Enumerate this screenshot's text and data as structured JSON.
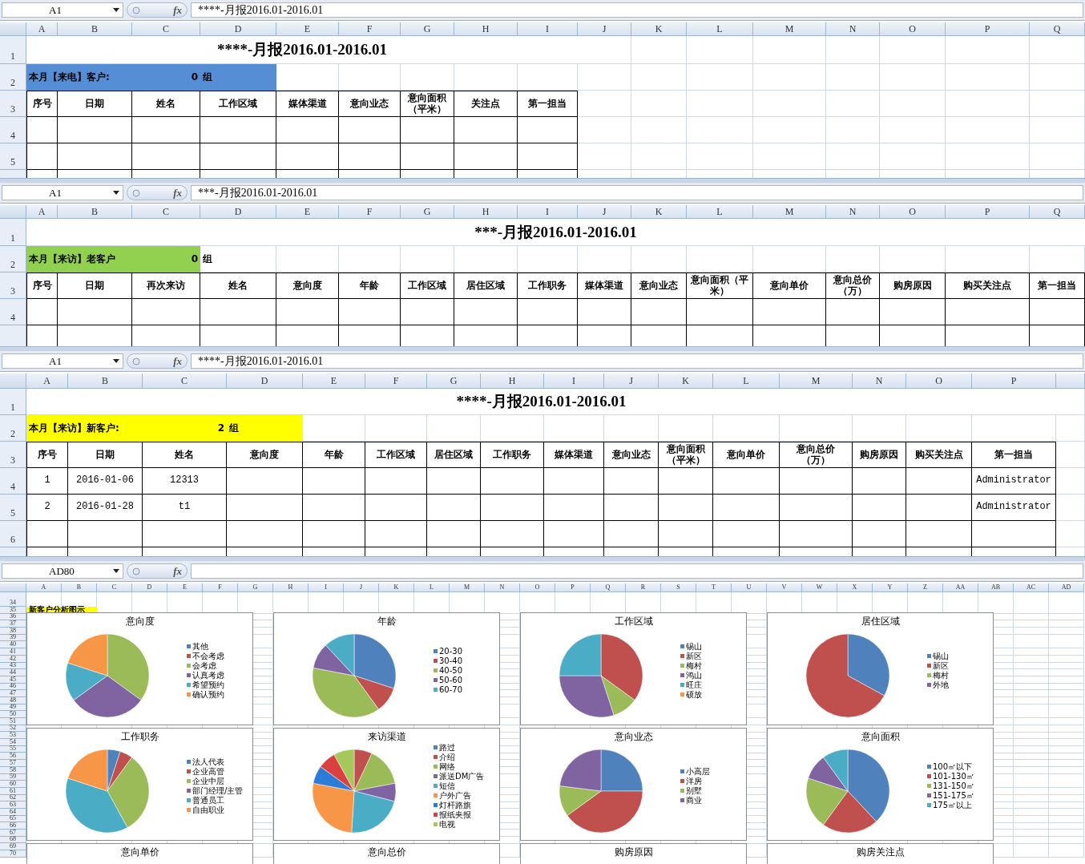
{
  "panes": [
    {
      "name_box": "A1",
      "function_label": "fx",
      "formula": "****-月报2016.01-2016.01",
      "columns": [
        "A",
        "B",
        "C",
        "D",
        "E",
        "F",
        "G",
        "H",
        "I",
        "J",
        "K",
        "L",
        "M",
        "N",
        "O",
        "P",
        "Q"
      ],
      "row_numbers": [
        "1",
        "2",
        "3",
        "4",
        "5"
      ],
      "title": "****-月报2016.01-2016.01",
      "banner": {
        "label": "本月【来电】客户:",
        "count": "0",
        "unit": "组",
        "color": "#558ed5"
      },
      "headers": [
        "序号",
        "日期",
        "姓名",
        "工作区域",
        "媒体渠道",
        "意向业态",
        "意向面积（平米）",
        "关注点",
        "第一担当"
      ]
    },
    {
      "name_box": "A1",
      "function_label": "fx",
      "formula": "***-月报2016.01-2016.01",
      "columns": [
        "A",
        "B",
        "C",
        "D",
        "E",
        "F",
        "G",
        "H",
        "I",
        "J",
        "K",
        "L",
        "M",
        "N",
        "O",
        "P",
        "Q"
      ],
      "row_numbers": [
        "1",
        "2",
        "3",
        "4"
      ],
      "title": "***-月报2016.01-2016.01",
      "banner": {
        "label": "本月【来访】老客户",
        "count": "0",
        "unit": "组",
        "color": "#92d050"
      },
      "headers": [
        "序号",
        "日期",
        "再次来访",
        "姓名",
        "意向度",
        "年龄",
        "工作区域",
        "居住区域",
        "工作职务",
        "媒体渠道",
        "意向业态",
        "意向面积（平米）",
        "意向单价",
        "意向总价（万）",
        "购房原因",
        "购买关注点",
        "第一担当"
      ]
    },
    {
      "name_box": "A1",
      "function_label": "fx",
      "formula": "****-月报2016.01-2016.01",
      "columns": [
        "A",
        "B",
        "C",
        "D",
        "E",
        "F",
        "G",
        "H",
        "I",
        "J",
        "K",
        "L",
        "M",
        "N",
        "O",
        "P"
      ],
      "row_numbers": [
        "1",
        "2",
        "3",
        "4",
        "5",
        "6"
      ],
      "title": "****-月报2016.01-2016.01",
      "banner": {
        "label": "本月【来访】新客户:",
        "count": "2",
        "unit": "组",
        "color": "#ffff00"
      },
      "headers": [
        "序号",
        "日期",
        "姓名",
        "意向度",
        "年龄",
        "工作区域",
        "居住区域",
        "工作职务",
        "媒体渠道",
        "意向业态",
        "意向面积（平米）",
        "意向单价",
        "意向总价（万）",
        "购房原因",
        "购买关注点",
        "第一担当"
      ],
      "data_rows": [
        {
          "number": "1",
          "date": "2016-01-06",
          "name": "12313",
          "owner": "Administrator"
        },
        {
          "number": "2",
          "date": "2016-01-28",
          "name": "t1",
          "owner": "Administrator"
        }
      ]
    },
    {
      "name_box": "AD80",
      "function_label": "fx",
      "columns": [
        "A",
        "B",
        "C",
        "D",
        "E",
        "F",
        "G",
        "H",
        "I",
        "J",
        "K",
        "L",
        "M",
        "N",
        "O",
        "P",
        "Q",
        "R",
        "S",
        "T",
        "U",
        "V",
        "W",
        "X",
        "Y",
        "Z",
        "AA",
        "AB",
        "AC",
        "AD"
      ],
      "row_numbers": [
        "34",
        "35",
        "36",
        "37",
        "38",
        "39",
        "40",
        "41",
        "42",
        "43",
        "44",
        "45",
        "46",
        "47",
        "48",
        "49",
        "50",
        "51",
        "52",
        "53",
        "54",
        "55",
        "56",
        "57",
        "58",
        "59",
        "60",
        "61",
        "62",
        "63",
        "64",
        "65",
        "66",
        "67",
        "68",
        "69",
        "70"
      ],
      "banner": {
        "label": "新客户分析图示",
        "color": "#ffff00"
      }
    }
  ],
  "charts": [
    {
      "title": "意向度",
      "legend": [
        {
          "label": "其他",
          "color": "#4f81bd"
        },
        {
          "label": "不会考虑",
          "color": "#c0504d"
        },
        {
          "label": "会考虑",
          "color": "#9bbb59"
        },
        {
          "label": "认真考虑",
          "color": "#8064a2"
        },
        {
          "label": "希望预约",
          "color": "#4bacc6"
        },
        {
          "label": "确认预约",
          "color": "#f79646"
        }
      ]
    },
    {
      "title": "年龄",
      "legend": [
        {
          "label": "20-30",
          "color": "#4f81bd"
        },
        {
          "label": "30-40",
          "color": "#c0504d"
        },
        {
          "label": "40-50",
          "color": "#9bbb59"
        },
        {
          "label": "50-60",
          "color": "#8064a2"
        },
        {
          "label": "60-70",
          "color": "#4bacc6"
        }
      ]
    },
    {
      "title": "工作区域",
      "legend": [
        {
          "label": "锡山",
          "color": "#4f81bd"
        },
        {
          "label": "新区",
          "color": "#c0504d"
        },
        {
          "label": "梅村",
          "color": "#9bbb59"
        },
        {
          "label": "鸿山",
          "color": "#8064a2"
        },
        {
          "label": "旺庄",
          "color": "#4bacc6"
        },
        {
          "label": "硕放",
          "color": "#f79646"
        }
      ]
    },
    {
      "title": "居住区域",
      "legend": [
        {
          "label": "锡山",
          "color": "#4f81bd"
        },
        {
          "label": "新区",
          "color": "#c0504d"
        },
        {
          "label": "梅村",
          "color": "#9bbb59"
        },
        {
          "label": "外地",
          "color": "#8064a2"
        }
      ]
    },
    {
      "title": "工作职务",
      "legend": [
        {
          "label": "法人代表",
          "color": "#4f81bd"
        },
        {
          "label": "企业高管",
          "color": "#c0504d"
        },
        {
          "label": "企业中层",
          "color": "#9bbb59"
        },
        {
          "label": "部门经理/主管",
          "color": "#8064a2"
        },
        {
          "label": "普通员工",
          "color": "#4bacc6"
        },
        {
          "label": "自由职业",
          "color": "#f79646"
        }
      ]
    },
    {
      "title": "来访渠道",
      "legend": [
        {
          "label": "路过",
          "color": "#4f81bd"
        },
        {
          "label": "介绍",
          "color": "#c0504d"
        },
        {
          "label": "网络",
          "color": "#9bbb59"
        },
        {
          "label": "派送DM广告",
          "color": "#8064a2"
        },
        {
          "label": "短信",
          "color": "#4bacc6"
        },
        {
          "label": "户外广告",
          "color": "#f79646"
        },
        {
          "label": "灯杆路旗",
          "color": "#2c7bd6"
        },
        {
          "label": "报纸夹报",
          "color": "#d94040"
        },
        {
          "label": "电视",
          "color": "#a6c85a"
        }
      ]
    },
    {
      "title": "意向业态",
      "legend": [
        {
          "label": "小高层",
          "color": "#4f81bd"
        },
        {
          "label": "洋房",
          "color": "#c0504d"
        },
        {
          "label": "别墅",
          "color": "#9bbb59"
        },
        {
          "label": "商业",
          "color": "#8064a2"
        }
      ]
    },
    {
      "title": "意向面积",
      "legend": [
        {
          "label": "100㎡以下",
          "color": "#4f81bd"
        },
        {
          "label": "101-130㎡",
          "color": "#c0504d"
        },
        {
          "label": "131-150㎡",
          "color": "#9bbb59"
        },
        {
          "label": "151-175㎡",
          "color": "#8064a2"
        },
        {
          "label": "175㎡以上",
          "color": "#4bacc6"
        }
      ]
    },
    {
      "title": "意向单价"
    },
    {
      "title": "意向总价"
    },
    {
      "title": "购房原因"
    },
    {
      "title": "购房关注点"
    }
  ]
}
